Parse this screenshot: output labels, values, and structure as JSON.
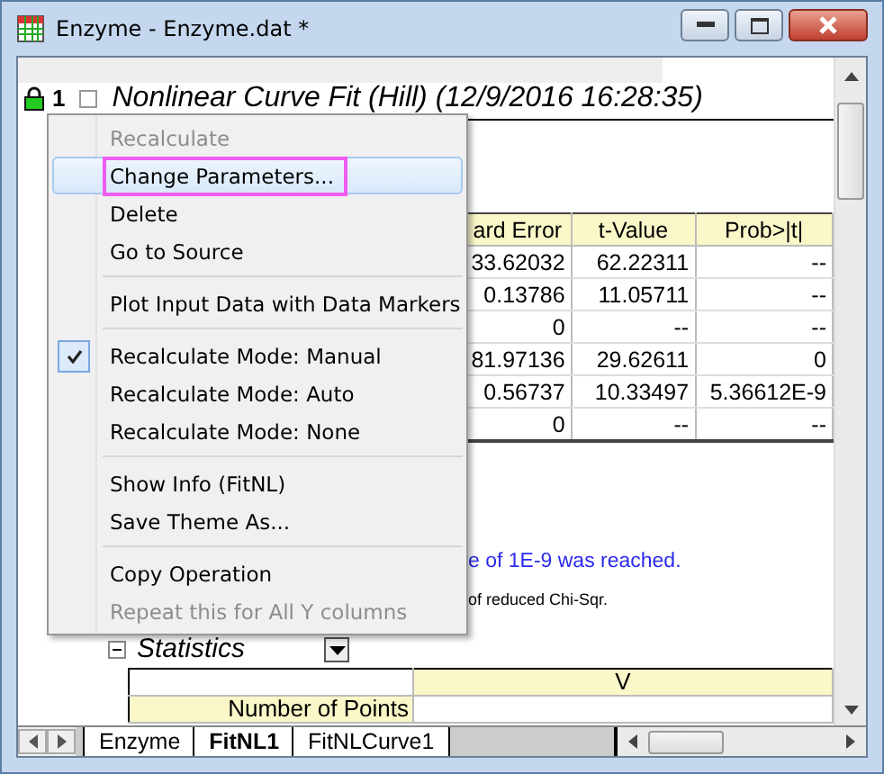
{
  "window": {
    "title": "Enzyme - Enzyme.dat *"
  },
  "report": {
    "row_number": "1",
    "title": "Nonlinear Curve Fit (Hill) (12/9/2016 16:28:35)",
    "table": {
      "columns": [
        "ard Error",
        "t-Value",
        "Prob>|t|"
      ],
      "rows": [
        [
          "33.62032",
          "62.22311",
          "--"
        ],
        [
          "0.13786",
          "11.05711",
          "--"
        ],
        [
          "0",
          "--",
          "--"
        ],
        [
          "81.97136",
          "29.62611",
          "0"
        ],
        [
          "0.56737",
          "10.33497",
          "5.36612E-9"
        ],
        [
          "0",
          "--",
          "--"
        ]
      ]
    },
    "messages": [
      {
        "kind": "info",
        "text": "e of 1E-9 was reached."
      },
      {
        "kind": "note",
        "text": "of reduced Chi-Sqr."
      }
    ],
    "statistics": {
      "title": "Statistics",
      "columns": [
        "V"
      ],
      "rows": [
        "Number of Points"
      ]
    }
  },
  "context_menu": {
    "items": [
      {
        "kind": "item",
        "label": "Recalculate",
        "disabled": true,
        "selected": false,
        "checked": false,
        "outlined": false
      },
      {
        "kind": "item",
        "label": "Change Parameters...",
        "disabled": false,
        "selected": true,
        "checked": false,
        "outlined": true
      },
      {
        "kind": "item",
        "label": "Delete",
        "disabled": false,
        "selected": false,
        "checked": false,
        "outlined": false
      },
      {
        "kind": "item",
        "label": "Go to Source",
        "disabled": false,
        "selected": false,
        "checked": false,
        "outlined": false
      },
      {
        "kind": "separator"
      },
      {
        "kind": "item",
        "label": "Plot Input Data with Data Markers",
        "disabled": false,
        "selected": false,
        "checked": false,
        "outlined": false
      },
      {
        "kind": "separator"
      },
      {
        "kind": "item",
        "label": "Recalculate Mode: Manual",
        "disabled": false,
        "selected": false,
        "checked": true,
        "outlined": false
      },
      {
        "kind": "item",
        "label": "Recalculate Mode: Auto",
        "disabled": false,
        "selected": false,
        "checked": false,
        "outlined": false
      },
      {
        "kind": "item",
        "label": "Recalculate Mode: None",
        "disabled": false,
        "selected": false,
        "checked": false,
        "outlined": false
      },
      {
        "kind": "separator"
      },
      {
        "kind": "item",
        "label": "Show Info (FitNL)",
        "disabled": false,
        "selected": false,
        "checked": false,
        "outlined": false
      },
      {
        "kind": "item",
        "label": "Save Theme As...",
        "disabled": false,
        "selected": false,
        "checked": false,
        "outlined": false
      },
      {
        "kind": "separator"
      },
      {
        "kind": "item",
        "label": "Copy Operation",
        "disabled": false,
        "selected": false,
        "checked": false,
        "outlined": false
      },
      {
        "kind": "item",
        "label": "Repeat this for All Y columns",
        "disabled": true,
        "selected": false,
        "checked": false,
        "outlined": false
      }
    ]
  },
  "sheet_tabs": [
    {
      "label": "Enzyme",
      "selected": false
    },
    {
      "label": "FitNL1",
      "selected": true
    },
    {
      "label": "FitNLCurve1",
      "selected": false
    }
  ]
}
